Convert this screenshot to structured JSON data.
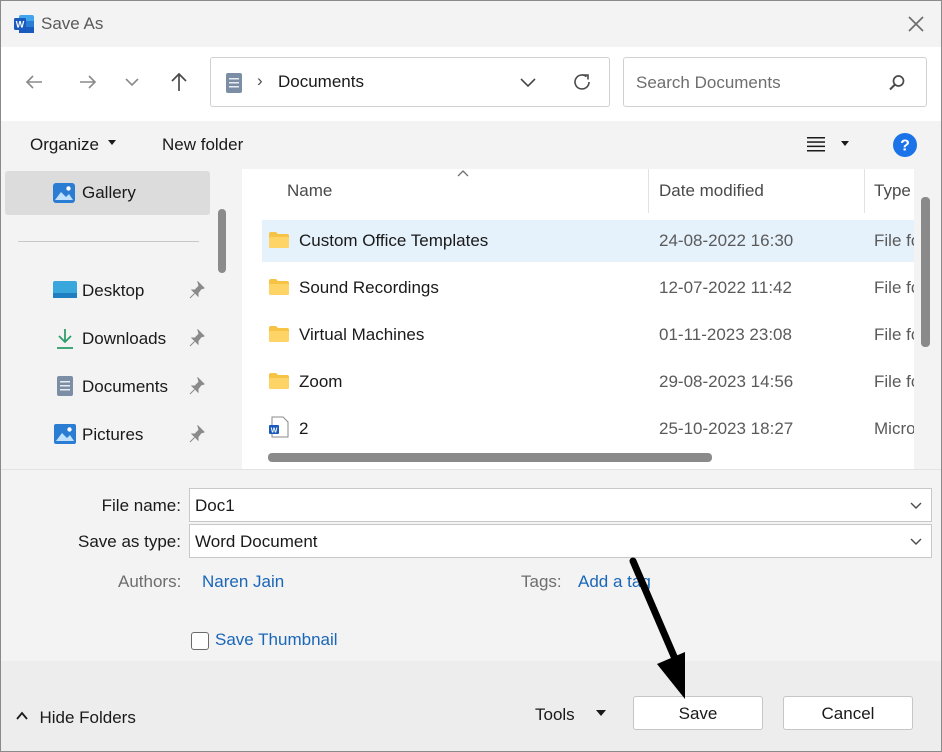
{
  "window": {
    "title": "Save As",
    "app_icon": "word-icon",
    "close_icon": "close-icon"
  },
  "navigation": {
    "back_icon": "arrow-left-icon",
    "forward_icon": "arrow-right-icon",
    "recent_icon": "chevron-down-icon",
    "up_icon": "arrow-up-icon",
    "address": {
      "location": "Documents",
      "separator": "›"
    },
    "search": {
      "placeholder": "Search Documents"
    }
  },
  "toolbar": {
    "organize_label": "Organize",
    "new_folder_label": "New folder"
  },
  "sidebar": {
    "items": [
      {
        "label": "Gallery",
        "icon": "gallery-icon",
        "selected": true,
        "pinned": false
      },
      {
        "label": "Desktop",
        "icon": "desktop-icon",
        "pinned": true
      },
      {
        "label": "Downloads",
        "icon": "download-icon",
        "pinned": true
      },
      {
        "label": "Documents",
        "icon": "document-icon",
        "pinned": true
      },
      {
        "label": "Pictures",
        "icon": "pictures-icon",
        "pinned": true
      }
    ]
  },
  "file_list": {
    "columns": [
      "Name",
      "Date modified",
      "Type"
    ],
    "rows": [
      {
        "name": "Custom Office Templates",
        "date": "24-08-2022 16:30",
        "type": "File fo",
        "icon": "folder-icon",
        "selected": true
      },
      {
        "name": "Sound Recordings",
        "date": "12-07-2022 11:42",
        "type": "File fo",
        "icon": "folder-icon"
      },
      {
        "name": "Virtual Machines",
        "date": "01-11-2023 23:08",
        "type": "File fo",
        "icon": "folder-icon"
      },
      {
        "name": "Zoom",
        "date": "29-08-2023 14:56",
        "type": "File fo",
        "icon": "folder-icon"
      },
      {
        "name": "2",
        "date": "25-10-2023 18:27",
        "type": "Micro",
        "icon": "word-file-icon"
      }
    ]
  },
  "form": {
    "file_name_label": "File name:",
    "file_name_value": "Doc1",
    "save_type_label": "Save as type:",
    "save_type_value": "Word Document",
    "authors_label": "Authors:",
    "authors_value": "Naren Jain",
    "tags_label": "Tags:",
    "tags_value": "Add a tag",
    "thumbnail_label": "Save Thumbnail",
    "thumbnail_checked": false
  },
  "footer": {
    "hide_folders_label": "Hide Folders",
    "tools_label": "Tools",
    "save_label": "Save",
    "cancel_label": "Cancel"
  },
  "colors": {
    "accent": "#1a66b8",
    "selected_row": "#e5f1fb",
    "help": "#1a73e8",
    "folder": "#f6c344"
  }
}
